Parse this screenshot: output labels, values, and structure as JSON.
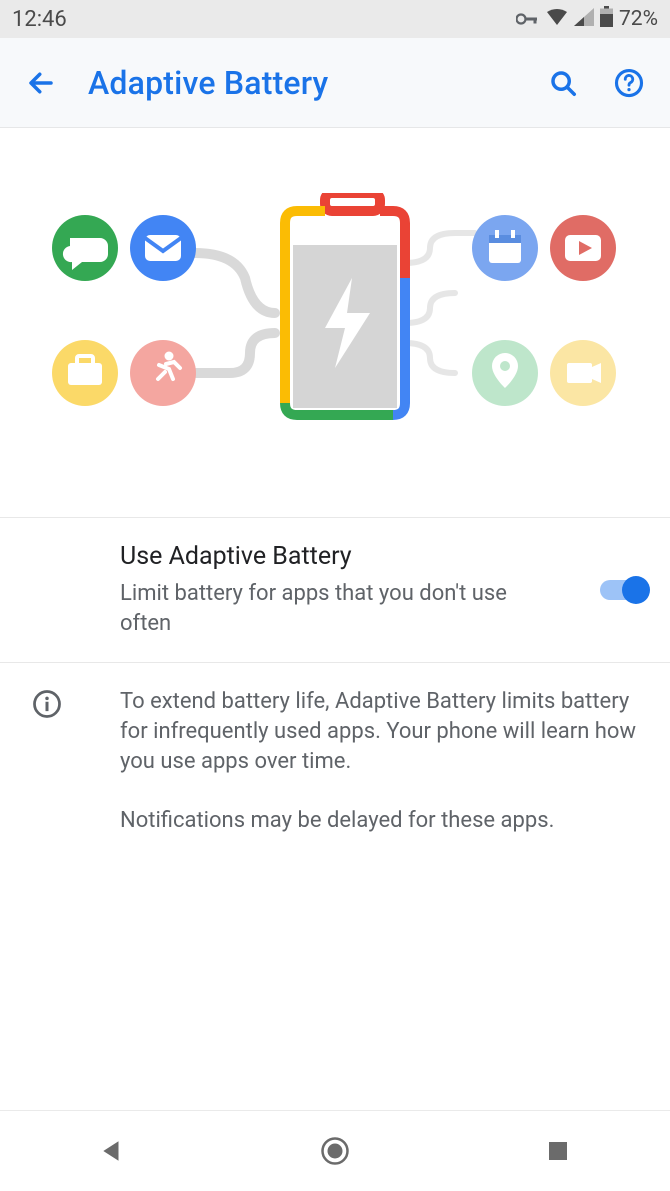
{
  "status": {
    "clock": "12:46",
    "battery_percent": "72%",
    "icons": {
      "vpn": "vpn-key-icon",
      "wifi": "wifi-icon",
      "signal": "cell-signal-icon",
      "battery": "battery-icon"
    }
  },
  "appbar": {
    "title": "Adaptive Battery",
    "back_icon": "arrow-back-icon",
    "search_icon": "search-icon",
    "help_icon": "help-circle-icon"
  },
  "colors": {
    "accent": "#1a73e8",
    "google_blue": "#4285F4",
    "google_red": "#EA4335",
    "google_yellow": "#FBBC04",
    "google_green": "#34A853",
    "muted": "#5f6368"
  },
  "hero": {
    "apps_active": [
      {
        "name": "chat-icon",
        "color": "#34A853"
      },
      {
        "name": "mail-icon",
        "color": "#4285F4"
      },
      {
        "name": "briefcase-icon",
        "color": "#FBD968"
      },
      {
        "name": "run-icon",
        "color": "#F4A6A0"
      }
    ],
    "apps_limited": [
      {
        "name": "calendar-icon",
        "color": "#7BA6F0"
      },
      {
        "name": "video-icon",
        "color": "#E06C65"
      },
      {
        "name": "location-icon",
        "color": "#BEE6CB"
      },
      {
        "name": "camera-icon",
        "color": "#FBE6A4"
      }
    ],
    "battery_icon": "battery-bolt-icon"
  },
  "settings": {
    "adaptive_battery": {
      "title": "Use Adaptive Battery",
      "subtitle": "Limit battery for apps that you don't use often",
      "enabled": true
    },
    "info": {
      "p1": "To extend battery life, Adaptive Battery limits battery for infrequently used apps. Your phone will learn how you use apps over time.",
      "p2": "Notifications may be delayed for these apps."
    }
  },
  "navbar": {
    "back": "nav-back-icon",
    "home": "nav-home-icon",
    "recents": "nav-recents-icon"
  }
}
